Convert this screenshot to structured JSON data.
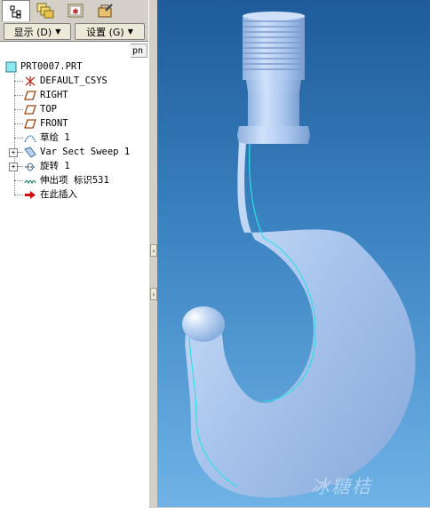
{
  "tabs": [
    "model-tree",
    "layers",
    "features",
    "tools"
  ],
  "toolbar": {
    "display_label": "显示 (D)",
    "settings_label": "设置 (G)"
  },
  "column_header": "pn",
  "tree": {
    "root": "PRT0007.PRT",
    "items": [
      {
        "label": "DEFAULT_CSYS",
        "icon": "csys-icon"
      },
      {
        "label": "RIGHT",
        "icon": "datum-plane-icon"
      },
      {
        "label": "TOP",
        "icon": "datum-plane-icon"
      },
      {
        "label": "FRONT",
        "icon": "datum-plane-icon"
      },
      {
        "label": "草绘 1",
        "icon": "sketch-icon"
      },
      {
        "label": "Var Sect Sweep 1",
        "icon": "sweep-icon",
        "expandable": true
      },
      {
        "label": "旋转 1",
        "icon": "revolve-icon",
        "expandable": true
      },
      {
        "label": "伸出项 标识531",
        "icon": "protrusion-icon"
      },
      {
        "label": "在此插入",
        "icon": "insert-here-arrow-icon"
      }
    ]
  },
  "viewport": {
    "watermark": "冰糖桔",
    "background_top": "#1f5b9a",
    "background_bottom": "#6fb3e6",
    "model_color": "#a9c5ee"
  }
}
